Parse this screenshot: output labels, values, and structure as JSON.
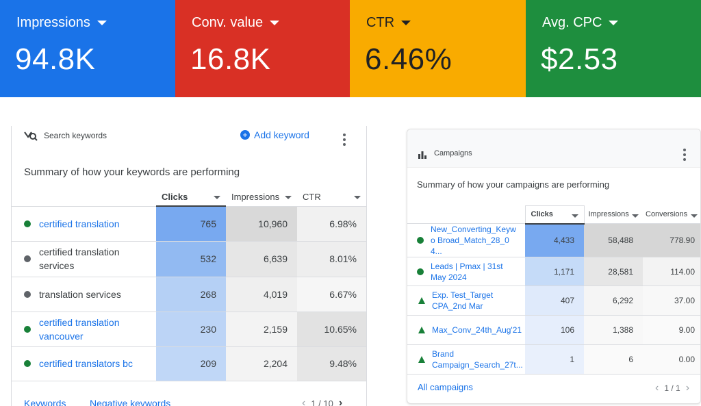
{
  "kpis": [
    {
      "label": "Impressions",
      "value": "94.8K",
      "color": "#1a73e8"
    },
    {
      "label": "Conv. value",
      "value": "16.8K",
      "color": "#d93025"
    },
    {
      "label": "CTR",
      "value": "6.46%",
      "color": "#f9ab00"
    },
    {
      "label": "Avg. CPC",
      "value": "$2.53",
      "color": "#1e8e3e"
    }
  ],
  "keywords_card": {
    "title": "Search keywords",
    "add_label": "Add keyword",
    "summary": "Summary of how your keywords are performing",
    "columns": [
      "Clicks",
      "Impressions",
      "CTR"
    ],
    "rows": [
      {
        "name": "certified translation",
        "status": "green",
        "linked": true,
        "clicks": "765",
        "impressions": "10,960",
        "ctr": "6.98%"
      },
      {
        "name": "certified translation services",
        "status": "gray",
        "linked": false,
        "clicks": "532",
        "impressions": "6,639",
        "ctr": "8.01%"
      },
      {
        "name": "translation services",
        "status": "gray",
        "linked": false,
        "clicks": "268",
        "impressions": "4,019",
        "ctr": "6.67%"
      },
      {
        "name": "certified translation vancouver",
        "status": "green",
        "linked": true,
        "clicks": "230",
        "impressions": "2,159",
        "ctr": "10.65%"
      },
      {
        "name": "certified translators bc",
        "status": "green",
        "linked": true,
        "clicks": "209",
        "impressions": "2,204",
        "ctr": "9.48%"
      }
    ],
    "footer_links": [
      "Keywords",
      "Negative keywords"
    ],
    "pager": "1 / 10"
  },
  "campaigns_card": {
    "title": "Campaigns",
    "summary": "Summary of how your campaigns are performing",
    "columns": [
      "Clicks",
      "Impressions",
      "Conversions"
    ],
    "rows": [
      {
        "name": "New_Converting_Keywo Broad_Match_28_04...",
        "icon": "dot",
        "clicks": "4,433",
        "impressions": "58,488",
        "conversions": "778.90"
      },
      {
        "name": "Leads | Pmax | 31st May 2024",
        "icon": "dot",
        "clicks": "1,171",
        "impressions": "28,581",
        "conversions": "114.00"
      },
      {
        "name": "Exp. Test_Target CPA_2nd Mar",
        "icon": "flask",
        "clicks": "407",
        "impressions": "6,292",
        "conversions": "37.00"
      },
      {
        "name": "Max_Conv_24th_Aug'21",
        "icon": "flask",
        "clicks": "106",
        "impressions": "1,388",
        "conversions": "9.00"
      },
      {
        "name": "Brand Campaign_Search_27t...",
        "icon": "flask",
        "clicks": "1",
        "impressions": "6",
        "conversions": "0.00"
      }
    ],
    "footer_link": "All campaigns",
    "pager": "1 / 1"
  }
}
